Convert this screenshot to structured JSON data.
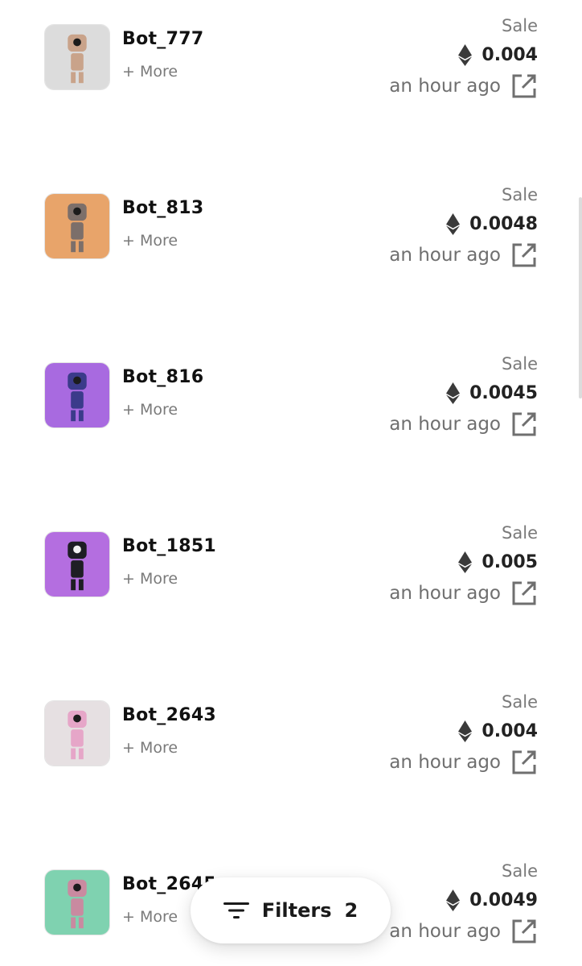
{
  "activity": [
    {
      "name": "Bot_777",
      "more": "+ More",
      "event": "Sale",
      "price": "0.004",
      "time": "an hour ago",
      "thumb_bg": "#dcdcdc",
      "thumb_accent": "#c9a38a"
    },
    {
      "name": "Bot_813",
      "more": "+ More",
      "event": "Sale",
      "price": "0.0048",
      "time": "an hour ago",
      "thumb_bg": "#e8a46a",
      "thumb_accent": "#7c6f6a"
    },
    {
      "name": "Bot_816",
      "more": "+ More",
      "event": "Sale",
      "price": "0.0045",
      "time": "an hour ago",
      "thumb_bg": "#a86ae0",
      "thumb_accent": "#3b3b8a"
    },
    {
      "name": "Bot_1851",
      "more": "+ More",
      "event": "Sale",
      "price": "0.005",
      "time": "an hour ago",
      "thumb_bg": "#b46ee0",
      "thumb_accent": "#1e1e24"
    },
    {
      "name": "Bot_2643",
      "more": "+ More",
      "event": "Sale",
      "price": "0.004",
      "time": "an hour ago",
      "thumb_bg": "#e6e0e2",
      "thumb_accent": "#e6a6c8"
    },
    {
      "name": "Bot_2645",
      "more": "+ More",
      "event": "Sale",
      "price": "0.0049",
      "time": "an hour ago",
      "thumb_bg": "#7fd2b0",
      "thumb_accent": "#c98aa0"
    }
  ],
  "currency_icon": "ethereum-icon",
  "filters": {
    "label": "Filters",
    "count": "2",
    "icon": "filter-lines-icon"
  }
}
